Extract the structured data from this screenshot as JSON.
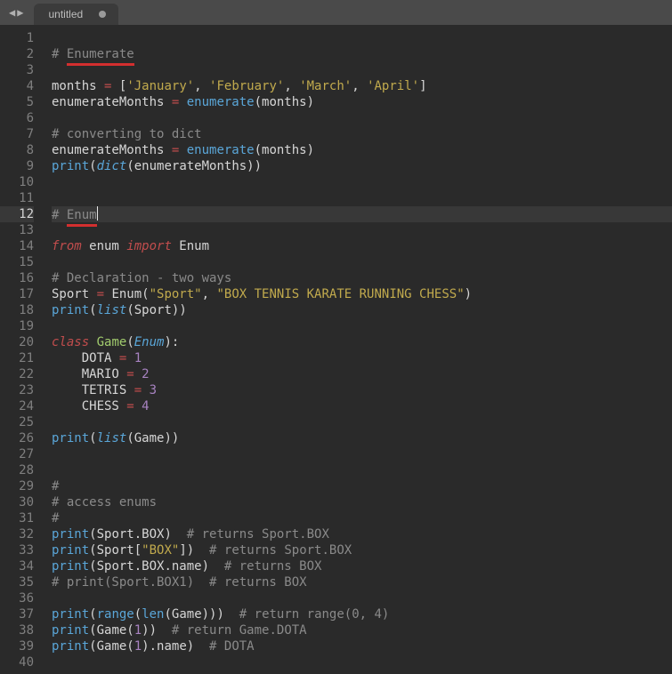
{
  "tabbar": {
    "nav_left": "◀",
    "nav_right": "▶",
    "tab_title": "untitled"
  },
  "code": {
    "active_line": 12,
    "lines": [
      {
        "n": 1,
        "t": ""
      },
      {
        "n": 2,
        "t": "# Enumerate",
        "segments": [
          {
            "c": "c-comment",
            "t": "# "
          },
          {
            "c": "c-comment underline-red",
            "t": "Enumerate"
          }
        ]
      },
      {
        "n": 3,
        "t": ""
      },
      {
        "n": 4,
        "segments": [
          {
            "c": "c-name",
            "t": "months "
          },
          {
            "c": "c-op",
            "t": "="
          },
          {
            "c": "",
            "t": " ["
          },
          {
            "c": "c-str",
            "t": "'January'"
          },
          {
            "c": "",
            "t": ", "
          },
          {
            "c": "c-str",
            "t": "'February'"
          },
          {
            "c": "",
            "t": ", "
          },
          {
            "c": "c-str",
            "t": "'March'"
          },
          {
            "c": "",
            "t": ", "
          },
          {
            "c": "c-str",
            "t": "'April'"
          },
          {
            "c": "",
            "t": "]"
          }
        ]
      },
      {
        "n": 5,
        "segments": [
          {
            "c": "c-name",
            "t": "enumerateMonths "
          },
          {
            "c": "c-op",
            "t": "="
          },
          {
            "c": "",
            "t": " "
          },
          {
            "c": "c-builtin",
            "t": "enumerate"
          },
          {
            "c": "",
            "t": "(months)"
          }
        ]
      },
      {
        "n": 6,
        "t": ""
      },
      {
        "n": 7,
        "segments": [
          {
            "c": "c-comment",
            "t": "# converting to dict"
          }
        ]
      },
      {
        "n": 8,
        "segments": [
          {
            "c": "c-name",
            "t": "enumerateMonths "
          },
          {
            "c": "c-op",
            "t": "="
          },
          {
            "c": "",
            "t": " "
          },
          {
            "c": "c-builtin",
            "t": "enumerate"
          },
          {
            "c": "",
            "t": "(months)"
          }
        ]
      },
      {
        "n": 9,
        "segments": [
          {
            "c": "c-builtin",
            "t": "print"
          },
          {
            "c": "",
            "t": "("
          },
          {
            "c": "c-type",
            "t": "dict"
          },
          {
            "c": "",
            "t": "(enumerateMonths))"
          }
        ]
      },
      {
        "n": 10,
        "t": ""
      },
      {
        "n": 11,
        "t": ""
      },
      {
        "n": 12,
        "active": true,
        "segments": [
          {
            "c": "c-comment",
            "t": "# "
          },
          {
            "c": "c-comment underline-red",
            "t": "Enum"
          },
          {
            "c": "cursor-holder",
            "t": ""
          }
        ]
      },
      {
        "n": 13,
        "t": ""
      },
      {
        "n": 14,
        "segments": [
          {
            "c": "c-kw",
            "t": "from"
          },
          {
            "c": "",
            "t": " enum "
          },
          {
            "c": "c-kw",
            "t": "import"
          },
          {
            "c": "",
            "t": " Enum"
          }
        ]
      },
      {
        "n": 15,
        "t": ""
      },
      {
        "n": 16,
        "segments": [
          {
            "c": "c-comment",
            "t": "# Declaration - two ways"
          }
        ]
      },
      {
        "n": 17,
        "segments": [
          {
            "c": "",
            "t": "Sport "
          },
          {
            "c": "c-op",
            "t": "="
          },
          {
            "c": "",
            "t": " Enum("
          },
          {
            "c": "c-str",
            "t": "\"Sport\""
          },
          {
            "c": "",
            "t": ", "
          },
          {
            "c": "c-str",
            "t": "\"BOX TENNIS KARATE RUNNING CHESS\""
          },
          {
            "c": "",
            "t": ")"
          }
        ]
      },
      {
        "n": 18,
        "segments": [
          {
            "c": "c-builtin",
            "t": "print"
          },
          {
            "c": "",
            "t": "("
          },
          {
            "c": "c-type",
            "t": "list"
          },
          {
            "c": "",
            "t": "(Sport))"
          }
        ]
      },
      {
        "n": 19,
        "t": ""
      },
      {
        "n": 20,
        "segments": [
          {
            "c": "c-kw",
            "t": "class"
          },
          {
            "c": "",
            "t": " "
          },
          {
            "c": "c-decl",
            "t": "Game"
          },
          {
            "c": "",
            "t": "("
          },
          {
            "c": "c-type",
            "t": "Enum"
          },
          {
            "c": "",
            "t": "):"
          }
        ]
      },
      {
        "n": 21,
        "segments": [
          {
            "c": "",
            "t": "    DOTA "
          },
          {
            "c": "c-op",
            "t": "="
          },
          {
            "c": "",
            "t": " "
          },
          {
            "c": "c-num",
            "t": "1"
          }
        ]
      },
      {
        "n": 22,
        "segments": [
          {
            "c": "",
            "t": "    MARIO "
          },
          {
            "c": "c-op",
            "t": "="
          },
          {
            "c": "",
            "t": " "
          },
          {
            "c": "c-num",
            "t": "2"
          }
        ]
      },
      {
        "n": 23,
        "segments": [
          {
            "c": "",
            "t": "    TETRIS "
          },
          {
            "c": "c-op",
            "t": "="
          },
          {
            "c": "",
            "t": " "
          },
          {
            "c": "c-num",
            "t": "3"
          }
        ]
      },
      {
        "n": 24,
        "segments": [
          {
            "c": "",
            "t": "    CHESS "
          },
          {
            "c": "c-op",
            "t": "="
          },
          {
            "c": "",
            "t": " "
          },
          {
            "c": "c-num",
            "t": "4"
          }
        ]
      },
      {
        "n": 25,
        "t": ""
      },
      {
        "n": 26,
        "segments": [
          {
            "c": "c-builtin",
            "t": "print"
          },
          {
            "c": "",
            "t": "("
          },
          {
            "c": "c-type",
            "t": "list"
          },
          {
            "c": "",
            "t": "(Game))"
          }
        ]
      },
      {
        "n": 27,
        "t": ""
      },
      {
        "n": 28,
        "t": ""
      },
      {
        "n": 29,
        "segments": [
          {
            "c": "c-comment",
            "t": "#"
          }
        ]
      },
      {
        "n": 30,
        "segments": [
          {
            "c": "c-comment",
            "t": "# access enums"
          }
        ]
      },
      {
        "n": 31,
        "segments": [
          {
            "c": "c-comment",
            "t": "#"
          }
        ]
      },
      {
        "n": 32,
        "segments": [
          {
            "c": "c-builtin",
            "t": "print"
          },
          {
            "c": "",
            "t": "(Sport.BOX)  "
          },
          {
            "c": "c-comment",
            "t": "# returns Sport.BOX"
          }
        ]
      },
      {
        "n": 33,
        "segments": [
          {
            "c": "c-builtin",
            "t": "print"
          },
          {
            "c": "",
            "t": "(Sport["
          },
          {
            "c": "c-str",
            "t": "\"BOX\""
          },
          {
            "c": "",
            "t": "])  "
          },
          {
            "c": "c-comment",
            "t": "# returns Sport.BOX"
          }
        ]
      },
      {
        "n": 34,
        "segments": [
          {
            "c": "c-builtin",
            "t": "print"
          },
          {
            "c": "",
            "t": "(Sport.BOX.name)  "
          },
          {
            "c": "c-comment",
            "t": "# returns BOX"
          }
        ]
      },
      {
        "n": 35,
        "segments": [
          {
            "c": "c-comment",
            "t": "# print(Sport.BOX1)  # returns BOX"
          }
        ]
      },
      {
        "n": 36,
        "t": ""
      },
      {
        "n": 37,
        "segments": [
          {
            "c": "c-builtin",
            "t": "print"
          },
          {
            "c": "",
            "t": "("
          },
          {
            "c": "c-builtin",
            "t": "range"
          },
          {
            "c": "",
            "t": "("
          },
          {
            "c": "c-builtin",
            "t": "len"
          },
          {
            "c": "",
            "t": "(Game)))  "
          },
          {
            "c": "c-comment",
            "t": "# return range(0, 4)"
          }
        ]
      },
      {
        "n": 38,
        "segments": [
          {
            "c": "c-builtin",
            "t": "print"
          },
          {
            "c": "",
            "t": "(Game("
          },
          {
            "c": "c-num",
            "t": "1"
          },
          {
            "c": "",
            "t": "))  "
          },
          {
            "c": "c-comment",
            "t": "# return Game.DOTA"
          }
        ]
      },
      {
        "n": 39,
        "segments": [
          {
            "c": "c-builtin",
            "t": "print"
          },
          {
            "c": "",
            "t": "(Game("
          },
          {
            "c": "c-num",
            "t": "1"
          },
          {
            "c": "",
            "t": ").name)  "
          },
          {
            "c": "c-comment",
            "t": "# DOTA"
          }
        ]
      },
      {
        "n": 40,
        "t": ""
      }
    ]
  }
}
